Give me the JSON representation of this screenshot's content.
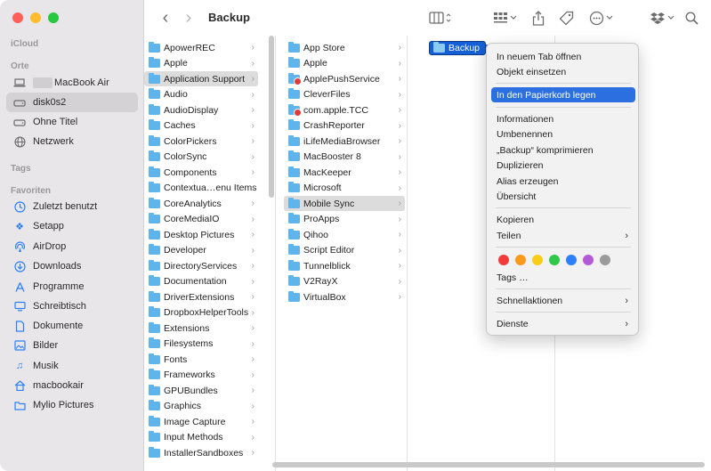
{
  "window": {
    "title": "Backup"
  },
  "sidebar": {
    "sections": {
      "icloud": "iCloud",
      "orte": "Orte",
      "tags": "Tags",
      "favoriten": "Favoriten"
    },
    "orte": [
      {
        "label": "MacBook Air",
        "icon": "laptop-icon"
      },
      {
        "label": "disk0s2",
        "icon": "disk-icon",
        "selected": true
      },
      {
        "label": "Ohne Titel",
        "icon": "disk-icon"
      },
      {
        "label": "Netzwerk",
        "icon": "globe-icon"
      }
    ],
    "favoriten": [
      {
        "label": "Zuletzt benutzt",
        "icon": "clock-icon"
      },
      {
        "label": "Setapp",
        "icon": "setapp-icon"
      },
      {
        "label": "AirDrop",
        "icon": "airdrop-icon"
      },
      {
        "label": "Downloads",
        "icon": "download-icon"
      },
      {
        "label": "Programme",
        "icon": "apps-icon"
      },
      {
        "label": "Schreibtisch",
        "icon": "desktop-icon"
      },
      {
        "label": "Dokumente",
        "icon": "document-icon"
      },
      {
        "label": "Bilder",
        "icon": "photo-icon"
      },
      {
        "label": "Musik",
        "icon": "music-icon"
      },
      {
        "label": "macbookair",
        "icon": "home-icon"
      },
      {
        "label": "Mylio Pictures",
        "icon": "folder-icon"
      }
    ]
  },
  "toolbar": {
    "back": "‹",
    "forward": "›"
  },
  "columns": {
    "col1": [
      "ApowerREC",
      "Apple",
      "Application Support",
      "Audio",
      "AudioDisplay",
      "Caches",
      "ColorPickers",
      "ColorSync",
      "Components",
      "Contextua…enu Items",
      "CoreAnalytics",
      "CoreMediaIO",
      "Desktop Pictures",
      "Developer",
      "DirectoryServices",
      "Documentation",
      "DriverExtensions",
      "DropboxHelperTools",
      "Extensions",
      "Filesystems",
      "Fonts",
      "Frameworks",
      "GPUBundles",
      "Graphics",
      "Image Capture",
      "Input Methods",
      "InstallerSandboxes"
    ],
    "col1_selected": 2,
    "col2": [
      "App Store",
      "Apple",
      "ApplePushService",
      "CleverFiles",
      "com.apple.TCC",
      "CrashReporter",
      "iLifeMediaBrowser",
      "MacBooster 8",
      "MacKeeper",
      "Microsoft",
      "Mobile Sync",
      "ProApps",
      "Qihoo",
      "Script Editor",
      "Tunnelblick",
      "V2RayX",
      "VirtualBox"
    ],
    "col2_selected": 10,
    "col2_restricted": [
      2,
      4
    ],
    "col3": [
      "Backup"
    ]
  },
  "context_menu": {
    "group1": [
      "In neuem Tab öffnen",
      "Objekt einsetzen"
    ],
    "group2": [
      "In den Papierkorb legen"
    ],
    "group3": [
      "Informationen",
      "Umbenennen",
      "„Backup“ komprimieren",
      "Duplizieren",
      "Alias erzeugen",
      "Übersicht"
    ],
    "group4": [
      "Kopieren",
      "Teilen"
    ],
    "tags_label": "Tags …",
    "tag_colors": [
      "#f23c3c",
      "#f89a1c",
      "#f7cd19",
      "#2ec94a",
      "#2d7ff9",
      "#b55ad6",
      "#9b9b9b"
    ],
    "group5": [
      "Schnellaktionen"
    ],
    "group6": [
      "Dienste"
    ]
  }
}
